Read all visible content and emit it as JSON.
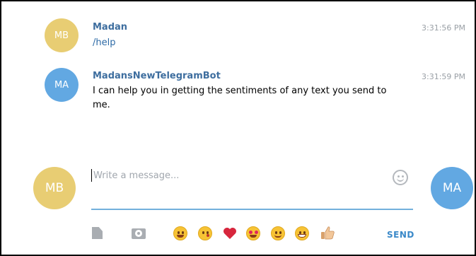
{
  "messages": [
    {
      "avatar_initials": "MB",
      "sender": "Madan",
      "text": "/help",
      "time": "3:31:56 PM"
    },
    {
      "avatar_initials": "MA",
      "sender": "MadansNewTelegramBot",
      "text_line1": "I can help you in getting the sentiments of any text you send to",
      "text_line2": "me.",
      "time": "3:31:59 PM"
    }
  ],
  "composer": {
    "placeholder": "Write a message...",
    "self_avatar_initials": "MB",
    "peer_avatar_initials": "MA",
    "send_label": "SEND",
    "emojis": [
      "😂",
      "😘",
      "❤",
      "😍",
      "😊",
      "😁",
      "👍"
    ]
  },
  "colors": {
    "avatar_mb": "#e8cd73",
    "avatar_ma": "#62a8e2",
    "sender_name": "#3e6e9f",
    "send_button": "#3a89c9",
    "input_underline": "#73b0dc"
  }
}
